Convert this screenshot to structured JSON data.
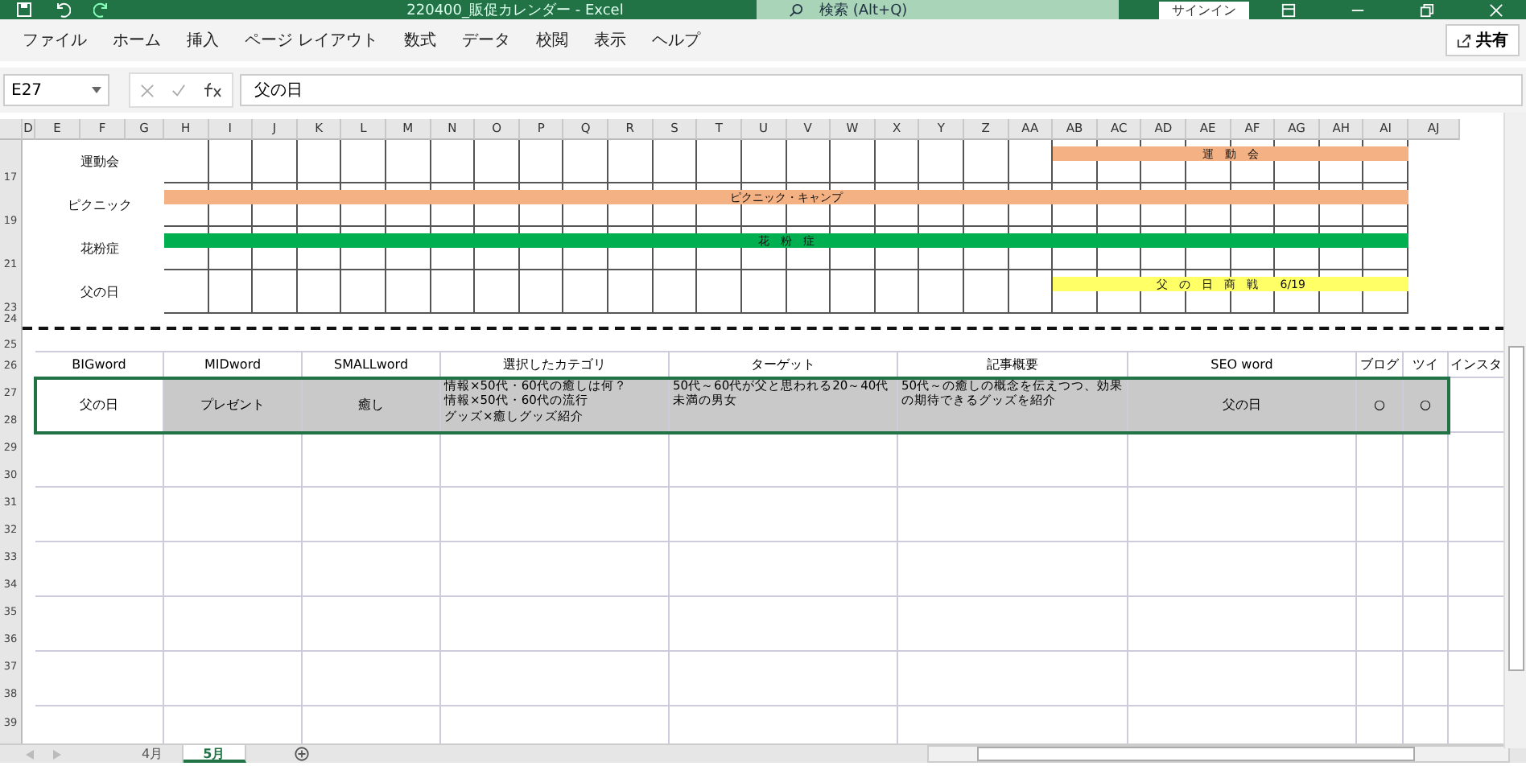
{
  "window": {
    "title": "220400_販促カレンダー  -  Excel",
    "search": "検索 (Alt+Q)",
    "signin": "サインイン"
  },
  "menu": [
    {
      "label": "ファイル"
    },
    {
      "label": "ホーム"
    },
    {
      "label": "挿入"
    },
    {
      "label": "ページ レイアウト"
    },
    {
      "label": "数式"
    },
    {
      "label": "データ"
    },
    {
      "label": "校閲"
    },
    {
      "label": "表示"
    },
    {
      "label": "ヘルプ"
    }
  ],
  "share": "共有",
  "formula_bar": {
    "name_box": "E27",
    "value": "父の日"
  },
  "columns": [
    "D",
    "E",
    "F",
    "G",
    "H",
    "I",
    "J",
    "K",
    "L",
    "M",
    "N",
    "O",
    "P",
    "Q",
    "R",
    "S",
    "T",
    "U",
    "V",
    "W",
    "X",
    "Y",
    "Z",
    "AA",
    "AB",
    "AC",
    "AD",
    "AE",
    "AF",
    "AG",
    "AH",
    "AI",
    "AJ"
  ],
  "events": [
    {
      "row": "17",
      "label": "運動会",
      "bar_text": "運　動　会",
      "kind": "late",
      "color": "#f4b183"
    },
    {
      "row": "19",
      "label": "ピクニック",
      "bar_text": "ピクニック・キャンプ",
      "kind": "full",
      "color": "#f4b183"
    },
    {
      "row": "21",
      "label": "花粉症",
      "bar_text": "花　粉　症",
      "kind": "full",
      "color": "#00b050"
    },
    {
      "row": "23",
      "label": "父の日",
      "bar_text": "父　の　日　商　戦　　6/19",
      "kind": "late",
      "color": "#ffff66"
    }
  ],
  "separator_rows": [
    "24",
    "25"
  ],
  "table": {
    "header_row": "26",
    "columns": [
      {
        "label": "BIGword",
        "kind": "short"
      },
      {
        "label": "MIDword",
        "kind": "short"
      },
      {
        "label": "SMALLword",
        "kind": "short"
      },
      {
        "label": "選択したカテゴリ",
        "kind": "note"
      },
      {
        "label": "ターゲット",
        "kind": "note"
      },
      {
        "label": "記事概要",
        "kind": "note"
      },
      {
        "label": "SEO  word",
        "kind": "short"
      },
      {
        "label": "ブログ",
        "kind": "short"
      },
      {
        "label": "ツイ",
        "kind": "short"
      },
      {
        "label": "インスタ",
        "kind": "short"
      }
    ],
    "rows": [
      {
        "row_numbers": [
          "27",
          "28"
        ],
        "selected": true,
        "cells": [
          {
            "text": "父の日",
            "shaded": false
          },
          {
            "text": "プレゼント",
            "shaded": true
          },
          {
            "text": "癒し",
            "shaded": true
          },
          {
            "lines": [
              "情報×50代・60代の癒しは何？",
              "情報×50代・60代の流行",
              "グッズ×癒しグッズ紹介"
            ],
            "shaded": true
          },
          {
            "text": "50代～60代が父と思われる20～40代未満の男女",
            "shaded": true
          },
          {
            "text": "50代～の癒しの概念を伝えつつ、効果の期待できるグッズを紹介",
            "shaded": true
          },
          {
            "text": "父の日",
            "shaded": true
          },
          {
            "text": "○",
            "shaded": true
          },
          {
            "text": "○",
            "shaded": true
          },
          {
            "shaded": false
          }
        ]
      }
    ],
    "empty_rows": [
      [
        "29",
        "30"
      ],
      [
        "31",
        "32"
      ],
      [
        "33",
        "34"
      ],
      [
        "35",
        "36"
      ],
      [
        "37",
        "38"
      ],
      [
        "39"
      ]
    ]
  },
  "sheets": [
    {
      "label": "4月",
      "selected": false
    },
    {
      "label": "5月",
      "selected": true
    }
  ]
}
